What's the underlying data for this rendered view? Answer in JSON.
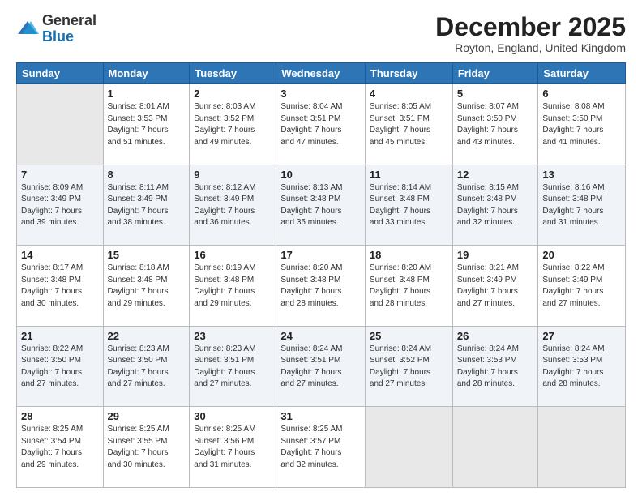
{
  "logo": {
    "general": "General",
    "blue": "Blue"
  },
  "header": {
    "month": "December 2025",
    "location": "Royton, England, United Kingdom"
  },
  "weekdays": [
    "Sunday",
    "Monday",
    "Tuesday",
    "Wednesday",
    "Thursday",
    "Friday",
    "Saturday"
  ],
  "weeks": [
    [
      {
        "day": "",
        "empty": true
      },
      {
        "day": "1",
        "sunrise": "8:01 AM",
        "sunset": "3:53 PM",
        "daylight": "7 hours and 51 minutes."
      },
      {
        "day": "2",
        "sunrise": "8:03 AM",
        "sunset": "3:52 PM",
        "daylight": "7 hours and 49 minutes."
      },
      {
        "day": "3",
        "sunrise": "8:04 AM",
        "sunset": "3:51 PM",
        "daylight": "7 hours and 47 minutes."
      },
      {
        "day": "4",
        "sunrise": "8:05 AM",
        "sunset": "3:51 PM",
        "daylight": "7 hours and 45 minutes."
      },
      {
        "day": "5",
        "sunrise": "8:07 AM",
        "sunset": "3:50 PM",
        "daylight": "7 hours and 43 minutes."
      },
      {
        "day": "6",
        "sunrise": "8:08 AM",
        "sunset": "3:50 PM",
        "daylight": "7 hours and 41 minutes."
      }
    ],
    [
      {
        "day": "7",
        "sunrise": "8:09 AM",
        "sunset": "3:49 PM",
        "daylight": "7 hours and 39 minutes."
      },
      {
        "day": "8",
        "sunrise": "8:11 AM",
        "sunset": "3:49 PM",
        "daylight": "7 hours and 38 minutes."
      },
      {
        "day": "9",
        "sunrise": "8:12 AM",
        "sunset": "3:49 PM",
        "daylight": "7 hours and 36 minutes."
      },
      {
        "day": "10",
        "sunrise": "8:13 AM",
        "sunset": "3:48 PM",
        "daylight": "7 hours and 35 minutes."
      },
      {
        "day": "11",
        "sunrise": "8:14 AM",
        "sunset": "3:48 PM",
        "daylight": "7 hours and 33 minutes."
      },
      {
        "day": "12",
        "sunrise": "8:15 AM",
        "sunset": "3:48 PM",
        "daylight": "7 hours and 32 minutes."
      },
      {
        "day": "13",
        "sunrise": "8:16 AM",
        "sunset": "3:48 PM",
        "daylight": "7 hours and 31 minutes."
      }
    ],
    [
      {
        "day": "14",
        "sunrise": "8:17 AM",
        "sunset": "3:48 PM",
        "daylight": "7 hours and 30 minutes."
      },
      {
        "day": "15",
        "sunrise": "8:18 AM",
        "sunset": "3:48 PM",
        "daylight": "7 hours and 29 minutes."
      },
      {
        "day": "16",
        "sunrise": "8:19 AM",
        "sunset": "3:48 PM",
        "daylight": "7 hours and 29 minutes."
      },
      {
        "day": "17",
        "sunrise": "8:20 AM",
        "sunset": "3:48 PM",
        "daylight": "7 hours and 28 minutes."
      },
      {
        "day": "18",
        "sunrise": "8:20 AM",
        "sunset": "3:48 PM",
        "daylight": "7 hours and 28 minutes."
      },
      {
        "day": "19",
        "sunrise": "8:21 AM",
        "sunset": "3:49 PM",
        "daylight": "7 hours and 27 minutes."
      },
      {
        "day": "20",
        "sunrise": "8:22 AM",
        "sunset": "3:49 PM",
        "daylight": "7 hours and 27 minutes."
      }
    ],
    [
      {
        "day": "21",
        "sunrise": "8:22 AM",
        "sunset": "3:50 PM",
        "daylight": "7 hours and 27 minutes."
      },
      {
        "day": "22",
        "sunrise": "8:23 AM",
        "sunset": "3:50 PM",
        "daylight": "7 hours and 27 minutes."
      },
      {
        "day": "23",
        "sunrise": "8:23 AM",
        "sunset": "3:51 PM",
        "daylight": "7 hours and 27 minutes."
      },
      {
        "day": "24",
        "sunrise": "8:24 AM",
        "sunset": "3:51 PM",
        "daylight": "7 hours and 27 minutes."
      },
      {
        "day": "25",
        "sunrise": "8:24 AM",
        "sunset": "3:52 PM",
        "daylight": "7 hours and 27 minutes."
      },
      {
        "day": "26",
        "sunrise": "8:24 AM",
        "sunset": "3:53 PM",
        "daylight": "7 hours and 28 minutes."
      },
      {
        "day": "27",
        "sunrise": "8:24 AM",
        "sunset": "3:53 PM",
        "daylight": "7 hours and 28 minutes."
      }
    ],
    [
      {
        "day": "28",
        "sunrise": "8:25 AM",
        "sunset": "3:54 PM",
        "daylight": "7 hours and 29 minutes."
      },
      {
        "day": "29",
        "sunrise": "8:25 AM",
        "sunset": "3:55 PM",
        "daylight": "7 hours and 30 minutes."
      },
      {
        "day": "30",
        "sunrise": "8:25 AM",
        "sunset": "3:56 PM",
        "daylight": "7 hours and 31 minutes."
      },
      {
        "day": "31",
        "sunrise": "8:25 AM",
        "sunset": "3:57 PM",
        "daylight": "7 hours and 32 minutes."
      },
      {
        "day": "",
        "empty": true
      },
      {
        "day": "",
        "empty": true
      },
      {
        "day": "",
        "empty": true
      }
    ]
  ],
  "labels": {
    "sunrise_prefix": "Sunrise: ",
    "sunset_prefix": "Sunset: ",
    "daylight_prefix": "Daylight: "
  }
}
